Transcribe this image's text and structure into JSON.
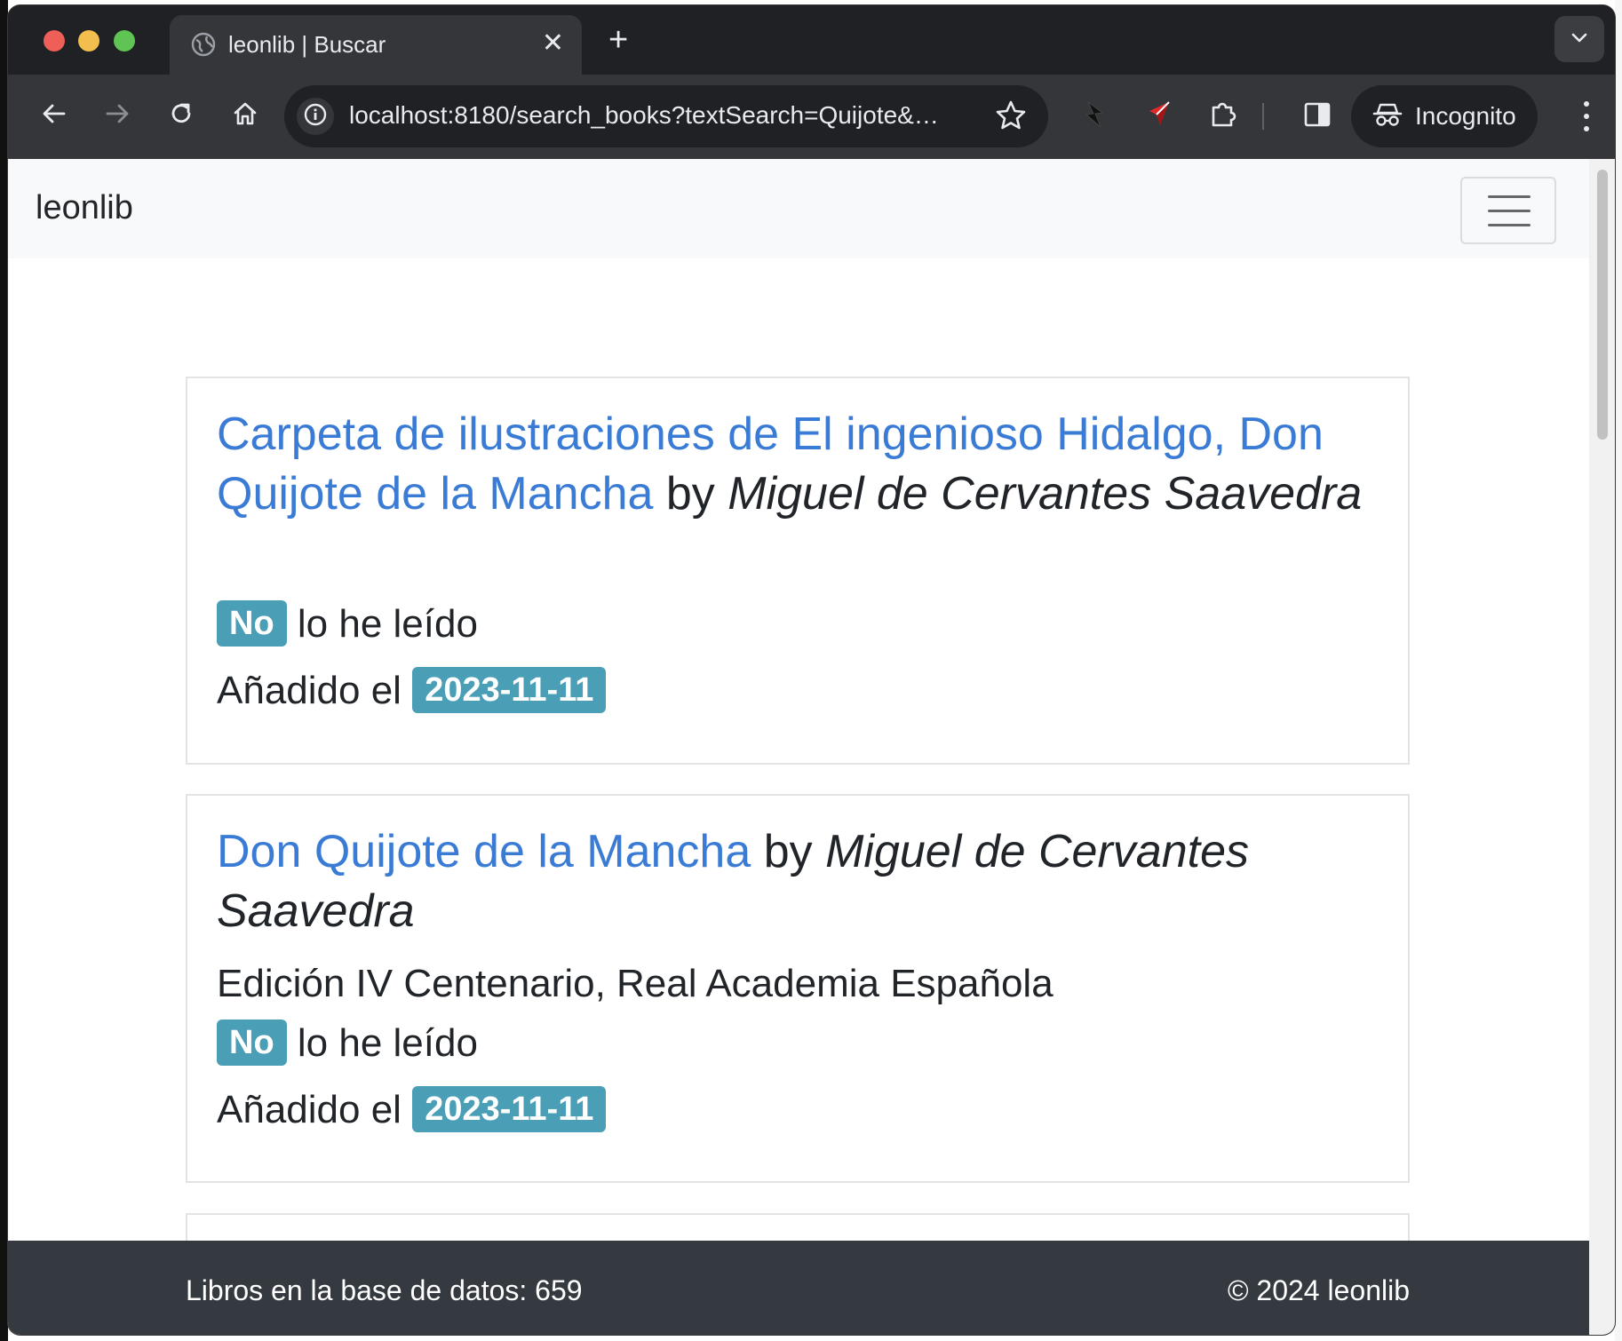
{
  "browser": {
    "tab_title": "leonlib | Buscar",
    "tab_close": "✕",
    "new_tab": "+",
    "url": "localhost:8180/search_books?textSearch=Quijote&…",
    "incognito_label": "Incognito"
  },
  "navbar": {
    "brand": "leonlib"
  },
  "results": [
    {
      "title": "Carpeta de ilustraciones de El ingenioso Hidalgo, Don Quijote de la Mancha",
      "by": "by",
      "author": "Miguel de Cervantes Saavedra",
      "edition": "",
      "read_badge": "No",
      "read_text": "lo he leído",
      "added_label": "Añadido el",
      "added_date": "2023-11-11"
    },
    {
      "title": "Don Quijote de la Mancha",
      "by": "by",
      "author": "Miguel de Cervantes Saavedra",
      "edition": "Edición IV Centenario, Real Academia Española",
      "read_badge": "No",
      "read_text": "lo he leído",
      "added_label": "Añadido el",
      "added_date": "2023-11-11"
    }
  ],
  "footer": {
    "count_text": "Libros en la base de datos: 659",
    "copyright": "© 2024 leonlib"
  },
  "colors": {
    "link": "#3a7bd5",
    "badge": "#4a9fb7",
    "footer_bg": "#343a40",
    "navbar_bg": "#f8f9fa"
  }
}
